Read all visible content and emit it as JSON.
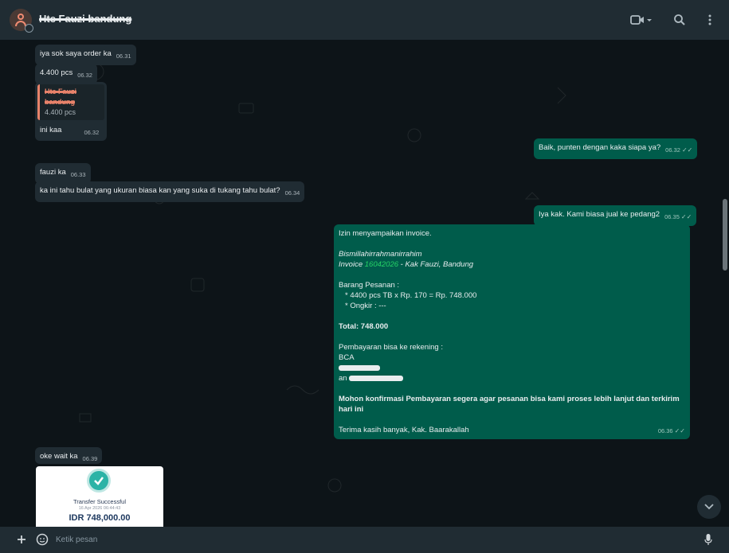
{
  "header": {
    "contact_name": "Hte Fauzi bandung",
    "icons": [
      "video-call-icon",
      "search-icon",
      "menu-icon"
    ]
  },
  "messages": [
    {
      "dir": "in",
      "text": "iya sok saya order ka",
      "time": "06.31"
    },
    {
      "dir": "in",
      "text": "4.400 pcs",
      "time": "06.32"
    },
    {
      "dir": "in",
      "quote_name": "Hte Fauzi bandung",
      "quote_text": "4.400 pcs"
    },
    {
      "dir": "in",
      "text": "ini kaa",
      "time": "06.32"
    },
    {
      "dir": "out",
      "text": "Baik, punten dengan kaka siapa ya?",
      "time": "06.32"
    },
    {
      "dir": "in",
      "text": "fauzi ka",
      "time": "06.33"
    },
    {
      "dir": "in",
      "text": "ka ini tahu bulat yang ukuran biasa kan yang suka di tukang tahu bulat?",
      "time": "06.34"
    },
    {
      "dir": "out",
      "text": "Iya kak. Kami biasa jual ke pedang2",
      "time": "06.35"
    },
    {
      "dir": "in",
      "text": "oke wait ka",
      "time": "06.39"
    }
  ],
  "invoice": {
    "line1": "Izin menyampaikan invoice.",
    "bismillah": "Bismillahirrahmanirrahim",
    "invoice_prefix": "Invoice ",
    "invoice_number": "16042026",
    "invoice_suffix": " - Kak Fauzi, Bandung",
    "items_header": "Barang Pesanan :",
    "item1": "* 4400 pcs TB x Rp. 170 = Rp. 748.000",
    "item2": "* Ongkir : ---",
    "total": "Total: 748.000",
    "payment_header": "Pembayaran bisa ke rekening :",
    "bank": "BCA",
    "account_prefix": "an",
    "confirm": "Mohon konfirmasi Pembayaran segera agar pesanan bisa kami proses lebih lanjut dan terkirim hari ini",
    "thanks": "Terima kasih banyak, Kak. Baarakallah",
    "time": "06.36"
  },
  "receipt": {
    "title": "Transfer Successful",
    "date": "16 Apr 2026 06:44:43",
    "amount": "IDR 748,000.00"
  },
  "composer": {
    "placeholder": "Ketik pesan"
  },
  "colors": {
    "incoming_bubble": "#202c33",
    "outgoing_bubble": "#005c4b",
    "accent_green": "#25d366",
    "background": "#0b141a"
  }
}
